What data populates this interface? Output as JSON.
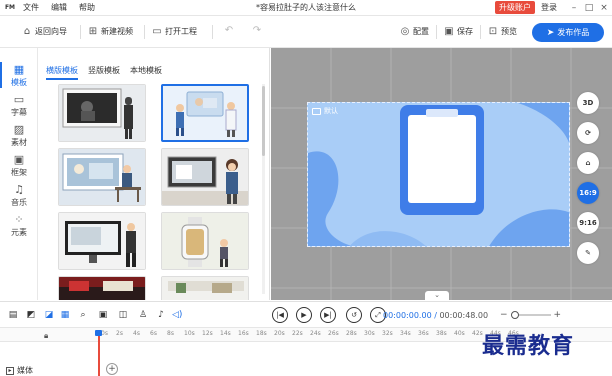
{
  "app": {
    "logo_text": "FM",
    "menu": [
      "文件",
      "编辑",
      "帮助"
    ],
    "doc_title": "*容易拉肚子的人该注意什么",
    "upgrade_label": "升级账户",
    "login_label": "登录"
  },
  "toolbar": {
    "back_label": "返回向导",
    "new_video_label": "新建视频",
    "open_project_label": "打开工程",
    "dub_label": "配置",
    "save_label": "保存",
    "preview_label": "预览",
    "publish_label": "发布作品"
  },
  "leftnav": {
    "items": [
      {
        "label": "模板",
        "icon": "template-icon",
        "active": true
      },
      {
        "label": "字幕",
        "icon": "subtitle-icon",
        "active": false
      },
      {
        "label": "素材",
        "icon": "material-icon",
        "active": false
      },
      {
        "label": "框架",
        "icon": "frame-icon",
        "active": false
      },
      {
        "label": "音乐",
        "icon": "music-icon",
        "active": false
      },
      {
        "label": "元素",
        "icon": "element-icon",
        "active": false
      }
    ]
  },
  "panel": {
    "tabs": [
      "横版模板",
      "竖版模板",
      "本地模板"
    ],
    "active_tab": 0
  },
  "canvas": {
    "label": "默认",
    "background": "#a9cdf7",
    "device_color": "#3f7de8"
  },
  "right_tools": [
    "3D",
    "⟳",
    "⌂",
    "16:9",
    "9:16",
    "✎"
  ],
  "timeline": {
    "current_time": "00:00:00.00",
    "total_time": "00:00:48.00",
    "separator": "/",
    "ruler_ticks": [
      "0s",
      "2s",
      "4s",
      "6s",
      "8s",
      "10s",
      "12s",
      "14s",
      "16s",
      "18s",
      "20s",
      "22s",
      "24s",
      "26s",
      "28s",
      "30s",
      "32s",
      "34s",
      "36s",
      "38s",
      "40s",
      "42s",
      "44s",
      "46s"
    ],
    "track_label": "媒体"
  },
  "watermark": "最需教育",
  "colors": {
    "accent": "#1f6fe5",
    "upgrade": "#e84b3c",
    "canvas_bg": "#9e9e9e"
  }
}
